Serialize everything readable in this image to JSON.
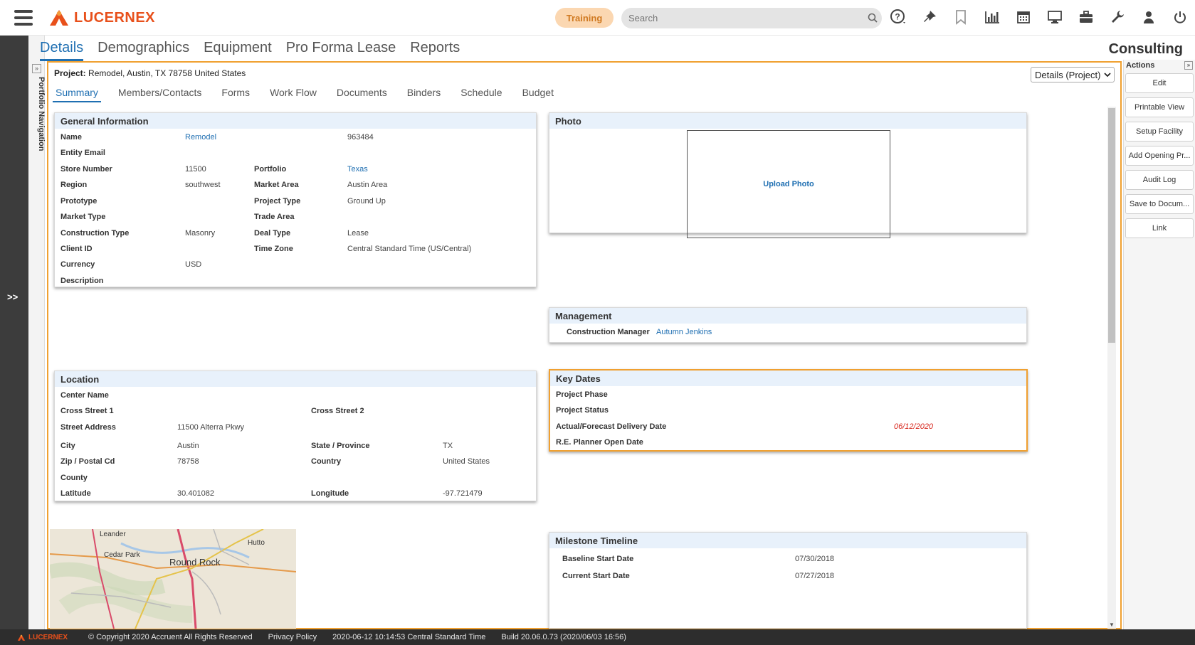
{
  "header": {
    "brand": "LUCERNEX",
    "training_label": "Training",
    "search_placeholder": "Search"
  },
  "main_tabs": [
    "Details",
    "Demographics",
    "Equipment",
    "Pro Forma Lease",
    "Reports"
  ],
  "consulting_label": "Consulting",
  "left_rail": {
    "expand_label": ">>",
    "portfolio_nav_label": "Portfolio Navigation"
  },
  "project": {
    "prefix": "Project:",
    "value": "Remodel, Austin, TX 78758 United States",
    "view_select": "Details (Project)"
  },
  "sub_tabs": [
    "Summary",
    "Members/Contacts",
    "Forms",
    "Work Flow",
    "Documents",
    "Binders",
    "Schedule",
    "Budget"
  ],
  "general": {
    "title": "General Information",
    "name_label": "Name",
    "name_value": "Remodel",
    "name_id": "963484",
    "entity_email_label": "Entity Email",
    "store_number_label": "Store Number",
    "store_number_value": "11500",
    "portfolio_label": "Portfolio",
    "portfolio_value": "Texas",
    "region_label": "Region",
    "region_value": "southwest",
    "market_area_label": "Market Area",
    "market_area_value": "Austin Area",
    "prototype_label": "Prototype",
    "project_type_label": "Project Type",
    "project_type_value": "Ground Up",
    "market_type_label": "Market Type",
    "trade_area_label": "Trade Area",
    "construction_type_label": "Construction Type",
    "construction_type_value": "Masonry",
    "deal_type_label": "Deal Type",
    "deal_type_value": "Lease",
    "client_id_label": "Client ID",
    "time_zone_label": "Time Zone",
    "time_zone_value": "Central Standard Time (US/Central)",
    "currency_label": "Currency",
    "currency_value": "USD",
    "description_label": "Description"
  },
  "photo": {
    "title": "Photo",
    "upload_label": "Upload Photo"
  },
  "management": {
    "title": "Management",
    "cm_label": "Construction Manager",
    "cm_value": "Autumn Jenkins"
  },
  "location": {
    "title": "Location",
    "center_name_label": "Center Name",
    "cross1_label": "Cross Street 1",
    "cross2_label": "Cross Street 2",
    "street_label": "Street Address",
    "street_value": "11500 Alterra Pkwy",
    "city_label": "City",
    "city_value": "Austin",
    "state_label": "State / Province",
    "state_value": "TX",
    "zip_label": "Zip / Postal Cd",
    "zip_value": "78758",
    "country_label": "Country",
    "country_value": "United States",
    "county_label": "County",
    "lat_label": "Latitude",
    "lat_value": "30.401082",
    "lon_label": "Longitude",
    "lon_value": "-97.721479"
  },
  "key_dates": {
    "title": "Key Dates",
    "phase_label": "Project Phase",
    "status_label": "Project Status",
    "delivery_label": "Actual/Forecast Delivery Date",
    "delivery_value": "06/12/2020",
    "planner_label": "R.E. Planner Open Date"
  },
  "map": {
    "labels": [
      "Leander",
      "Cedar Park",
      "Hutto",
      "Round Rock"
    ]
  },
  "milestone": {
    "title": "Milestone Timeline",
    "baseline_label": "Baseline Start Date",
    "baseline_value": "07/30/2018",
    "current_label": "Current Start Date",
    "current_value": "07/27/2018"
  },
  "actions": {
    "title": "Actions",
    "buttons": [
      "Edit",
      "Printable View",
      "Setup Facility",
      "Add Opening Pr...",
      "Audit Log",
      "Save to Docum...",
      "Link"
    ]
  },
  "footer": {
    "brand": "LUCERNEX",
    "copyright": "© Copyright 2020 Accruent All Rights Reserved",
    "privacy": "Privacy Policy",
    "timestamp": "2020-06-12 10:14:53 Central Standard Time",
    "build": "Build 20.06.0.73 (2020/06/03 16:56)"
  },
  "colors": {
    "brand": "#e8501b",
    "accent": "#1f6fb2",
    "frame": "#f0a030",
    "panel_header": "#e8f1fb"
  }
}
